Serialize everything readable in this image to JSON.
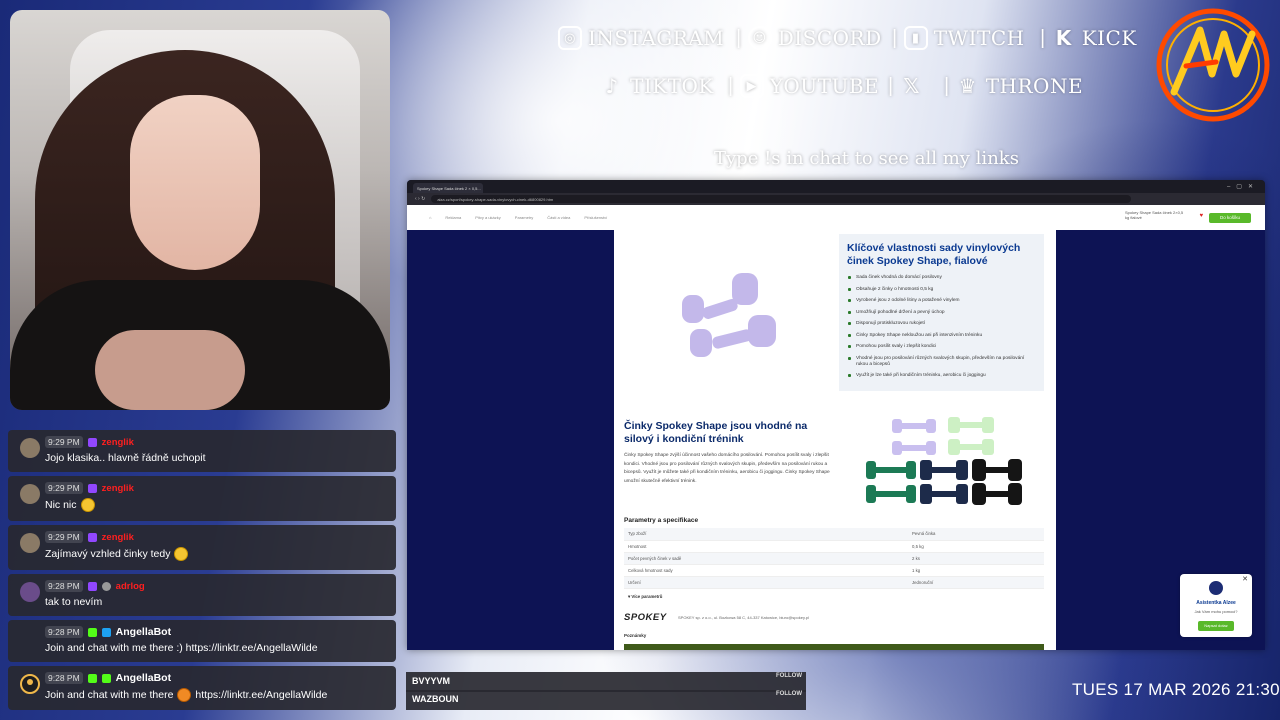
{
  "socials_row1": [
    {
      "icon": "instagram-icon",
      "glyph": "◎",
      "label": "INSTAGRAM"
    },
    {
      "icon": "discord-icon",
      "glyph": "☺",
      "label": "DISCORD"
    },
    {
      "icon": "twitch-icon",
      "glyph": "▮",
      "label": "TWITCH"
    },
    {
      "icon": "kick-icon",
      "glyph": "K",
      "label": "KICK"
    }
  ],
  "socials_row2": [
    {
      "icon": "tiktok-icon",
      "glyph": "♪",
      "label": "TIKTOK"
    },
    {
      "icon": "youtube-icon",
      "glyph": "▶",
      "label": "YOUTUBE"
    },
    {
      "icon": "x-icon",
      "glyph": "𝕏",
      "label": ""
    },
    {
      "icon": "throne-icon",
      "glyph": "♛",
      "label": "THRONE"
    }
  ],
  "tagline": "Type !s in chat to see all my links",
  "chat": [
    {
      "time": "9:29 PM",
      "user": "zenglik",
      "text": "Jojo klasika.. hlavně řádně uchopit",
      "emoji": ""
    },
    {
      "time": "9:29 PM",
      "user": "zenglik",
      "text": "Nic nic",
      "emoji": "grin"
    },
    {
      "time": "9:29 PM",
      "user": "zenglik",
      "text": "Zajímavý vzhled činky tedy",
      "emoji": "grin"
    },
    {
      "time": "9:28 PM",
      "user": "adrlog",
      "text": "tak to nevím",
      "emoji": ""
    },
    {
      "time": "9:28 PM",
      "user": "AngellaBot",
      "text": "Join and chat with me there :) https://linktr.ee/AngellaWilde",
      "emoji": ""
    },
    {
      "time": "9:28 PM",
      "user": "AngellaBot",
      "text_before": "Join and chat with me there",
      "text": "https://linktr.ee/AngellaWilde",
      "emoji": "tiger"
    }
  ],
  "follows": [
    {
      "name": "BVYYVM",
      "tag": "FOLLOW"
    },
    {
      "name": "WAZBOUN",
      "tag": "FOLLOW"
    }
  ],
  "datetime": "TUES 17 MAR 2026 21:30",
  "browser": {
    "tab_title": "Spokey Shape Sada činek 2 × 0,5...",
    "url": "alza.cz/sport/spokey-shape-sada-vinylovych-cinek-d6800829.htm",
    "nav": [
      "Reklama",
      "Pitvy a ukázky",
      "Parametry",
      "Části a videa",
      "Příslušenství"
    ],
    "cart_mini": "Spokey Shape Sada činek 2×0,5 kg fialové",
    "cart_button": "Do košíku",
    "features_title": "Klíčové vlastnosti sady vinylových činek Spokey Shape, fialové",
    "features": [
      "Sada činek vhodná do domácí posilovny",
      "Obsahuje 2 činky o hmotnosti 0,5 kg",
      "Vyrobené jsou z odolné litiny a potažené vinylem",
      "Umožňují pohodlné držení a pevný úchop",
      "Disponují protiskluzovou rukojetí",
      "Činky Spokey Shape nekloužou ani při intenzivním tréninku",
      "Pomohou posílit svaly i zlepšit kondici",
      "Vhodné jsou pro posilování různých svalových skupin, především na posilování rukou a bicepsů",
      "Využít je lze také při kondičním tréninku, aerobicu či joggingu"
    ],
    "section_title": "Činky Spokey Shape jsou vhodné na silový i kondiční trénink",
    "section_text": "Činky Spokey Shape zvýší účinnost vašeho domácího posilování. Pomohou posílit svaly i zlepšit kondici. Vhodné jsou pro posilování různých svalových skupin, především na posilování rukou a bicepsů. Využít je můžete také při kondičním tréninku, aerobicu či joggingu. Činky Spokey Shape umožní skutečně efektivní trénink.",
    "params_title": "Parametry a specifikace",
    "params": [
      [
        "Typ zboží",
        "Pevná činka"
      ],
      [
        "Hmotnost",
        "0,5 kg"
      ],
      [
        "Počet pevných činek v sadě",
        "2 ks"
      ],
      [
        "Celková hmotnost sady",
        "1 kg"
      ],
      [
        "Určení",
        "Jednoruční"
      ]
    ],
    "more_params": "Více parametrů",
    "brand": "SPOKEY",
    "company": "SPOKEY sp. z o.o., ul. Bozkowa 58 C, 44-337 Katowice, biuro@spokey.pl",
    "notes": "Poznámky",
    "assistant_title": "Asistentka Alzee",
    "assistant_text": "Jak Vám mohu pomoci?",
    "assistant_button": "Napsat dotaz"
  }
}
